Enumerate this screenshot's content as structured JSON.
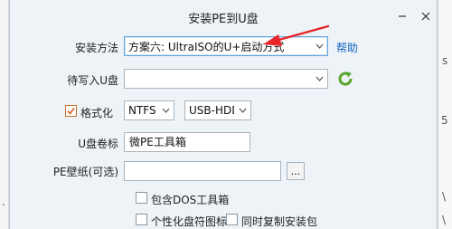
{
  "window": {
    "title": "安装PE到U盘"
  },
  "form": {
    "install_method": {
      "label": "安装方法",
      "value": "方案六: UltraISO的U+启动方式",
      "help_link": "帮助"
    },
    "target_disk": {
      "label": "待写入U盘",
      "value": ""
    },
    "format": {
      "label": "格式化",
      "checked": true,
      "filesystem": "NTFS",
      "mode": "USB-HDD"
    },
    "volume_label": {
      "label": "U盘卷标",
      "value": "微PE工具箱"
    },
    "wallpaper": {
      "label": "PE壁纸(可选)",
      "value": "",
      "browse_label": "..."
    },
    "options": {
      "include_dos": "包含DOS工具箱",
      "custom_icon": "个性化盘符图标",
      "copy_installer": "同时复制安装包"
    }
  },
  "annotation": {
    "arrow_color": "#e8262a"
  },
  "colors": {
    "dialog_bg": "#eef3f8",
    "link": "#1565c0",
    "refresh_green": "#5aa62a",
    "check_orange": "#c86b2a"
  }
}
